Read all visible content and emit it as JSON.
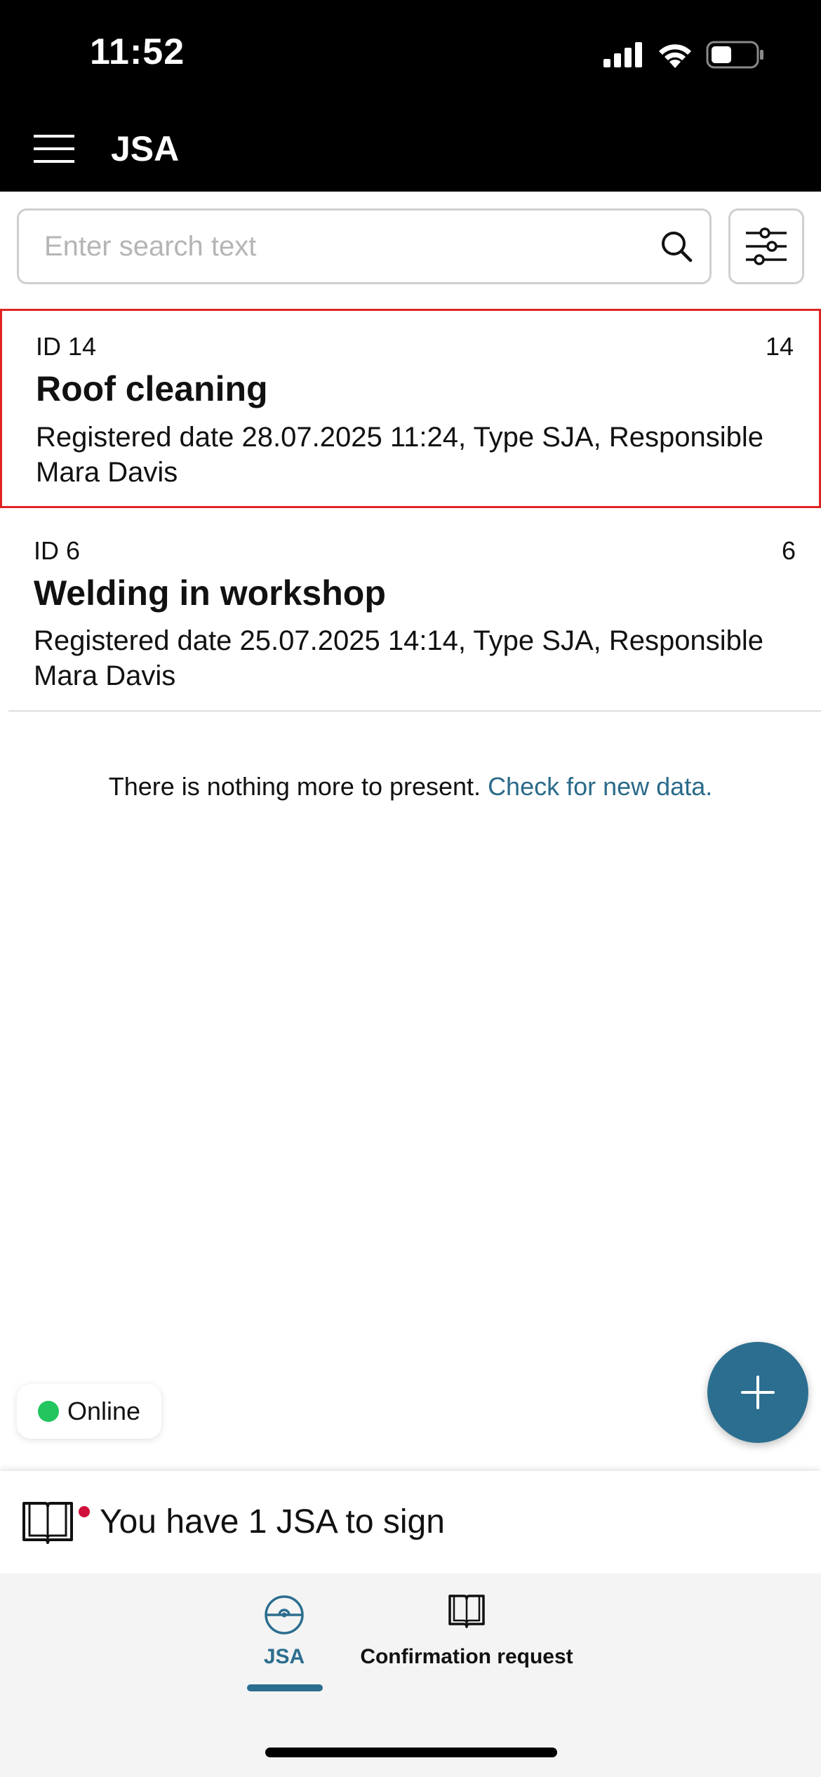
{
  "status_bar": {
    "time": "11:52"
  },
  "header": {
    "title": "JSA"
  },
  "search": {
    "placeholder": "Enter search text"
  },
  "list": {
    "items": [
      {
        "id_label": "ID 14",
        "count": "14",
        "title": "Roof cleaning",
        "description": "Registered date 28.07.2025 11:24, Type SJA, Responsible Mara Davis",
        "selected": true
      },
      {
        "id_label": "ID 6",
        "count": "6",
        "title": "Welding in workshop",
        "description": "Registered date 25.07.2025 14:14, Type SJA, Responsible Mara Davis",
        "selected": false
      }
    ],
    "end_message": "There is nothing more to present.",
    "refresh_link": "Check for new data."
  },
  "connection": {
    "status": "Online",
    "status_color": "#22c55e"
  },
  "sign_banner": {
    "text": "You have 1 JSA to sign",
    "notification_color": "#d0103a"
  },
  "tabs": [
    {
      "label": "JSA",
      "icon": "helmet-icon",
      "active": true
    },
    {
      "label": "Confirmation request",
      "icon": "book-open-icon",
      "active": false
    }
  ],
  "colors": {
    "accent": "#2c6e8f",
    "selection_border": "#e02424",
    "header_bg": "#000000"
  }
}
